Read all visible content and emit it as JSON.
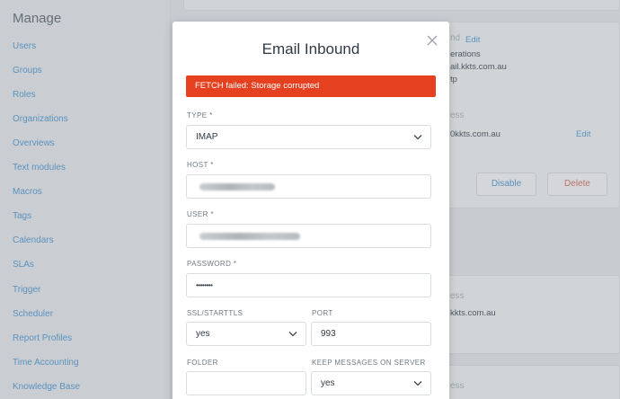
{
  "sidebar": {
    "title": "Manage",
    "items": [
      {
        "label": "Users"
      },
      {
        "label": "Groups"
      },
      {
        "label": "Roles"
      },
      {
        "label": "Organizations"
      },
      {
        "label": "Overviews"
      },
      {
        "label": "Text modules"
      },
      {
        "label": "Macros"
      },
      {
        "label": "Tags"
      },
      {
        "label": "Calendars"
      },
      {
        "label": "SLAs"
      },
      {
        "label": "Trigger"
      },
      {
        "label": "Scheduler"
      },
      {
        "label": "Report Profiles"
      },
      {
        "label": "Time Accounting"
      },
      {
        "label": "Knowledge Base"
      }
    ]
  },
  "background": {
    "card1": {
      "heading_fragment": "nd",
      "edit_label": "Edit",
      "line1": "erations",
      "line2": "ail.kkts.com.au",
      "line3": "tp"
    },
    "card2": {
      "heading_fragment": "ess",
      "address_fragment": "0kkts.com.au",
      "edit_label": "Edit",
      "disable_label": "Disable",
      "delete_label": "Delete"
    },
    "card3": {
      "heading_fragment": "ess",
      "address_fragment": "kkts.com.au"
    },
    "card4": {
      "heading_fragment": "ess"
    }
  },
  "modal": {
    "title": "Email Inbound",
    "close_icon": "close-icon",
    "alert": "FETCH failed: Storage corrupted",
    "fields": {
      "type": {
        "label": "TYPE *",
        "value": "IMAP"
      },
      "host": {
        "label": "HOST *",
        "value": ""
      },
      "user": {
        "label": "USER *",
        "value": ""
      },
      "password": {
        "label": "PASSWORD *",
        "value": "••••••••"
      },
      "ssl": {
        "label": "SSL/STARTTLS",
        "value": "yes"
      },
      "port": {
        "label": "PORT",
        "value": "993"
      },
      "folder": {
        "label": "FOLDER",
        "value": ""
      },
      "keep": {
        "label": "KEEP MESSAGES ON SERVER",
        "value": "yes"
      }
    }
  },
  "colors": {
    "accent": "#4d9ad8",
    "alert": "#e5401f",
    "delete": "#d9705f"
  }
}
